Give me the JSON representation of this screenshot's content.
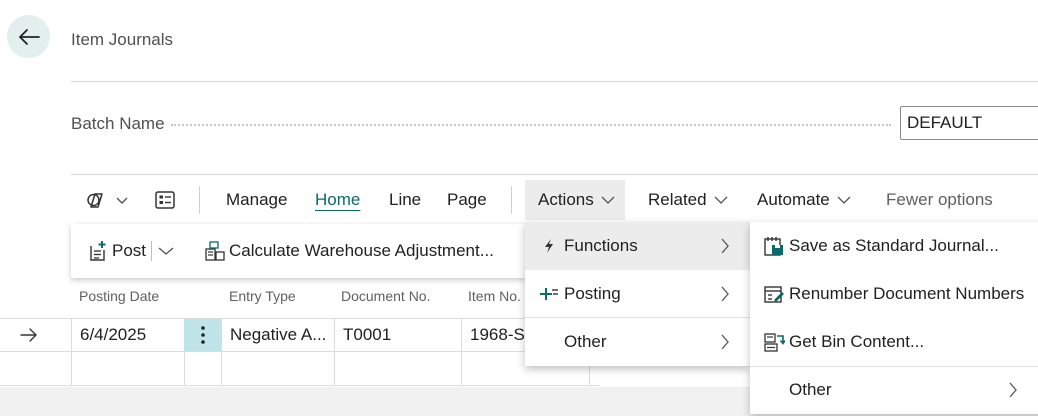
{
  "header": {
    "back_label": "Back",
    "title": "Item Journals"
  },
  "batch": {
    "label": "Batch Name",
    "value": "DEFAULT"
  },
  "toolbar": {
    "manage": "Manage",
    "home": "Home",
    "line": "Line",
    "page": "Page",
    "actions": "Actions",
    "related": "Related",
    "automate": "Automate",
    "fewer": "Fewer options"
  },
  "action_bar": {
    "post": "Post",
    "calc": "Calculate Warehouse Adjustment..."
  },
  "table": {
    "columns": [
      "Posting Date",
      "Entry Type",
      "Document No.",
      "Item No."
    ],
    "rows": [
      {
        "posting_date": "6/4/2025",
        "entry_type": "Negative A...",
        "document_no": "T0001",
        "item_no": "1968-S"
      }
    ]
  },
  "actions_menu": {
    "items": [
      {
        "label": "Functions",
        "icon": "lightning-icon"
      },
      {
        "label": "Posting",
        "icon": "post-plus-icon"
      },
      {
        "label": "Other",
        "icon": ""
      }
    ]
  },
  "functions_submenu": {
    "items": [
      {
        "label": "Save as Standard Journal...",
        "icon": "save-journal-icon"
      },
      {
        "label": "Renumber Document Numbers",
        "icon": "renumber-icon"
      },
      {
        "label": "Get Bin Content...",
        "icon": "bin-content-icon"
      },
      {
        "label": "Other",
        "icon": ""
      }
    ]
  },
  "colors": {
    "accent": "#0b6a6a",
    "selected_cell": "#bfe4ea",
    "menu_highlight": "#ececec"
  }
}
